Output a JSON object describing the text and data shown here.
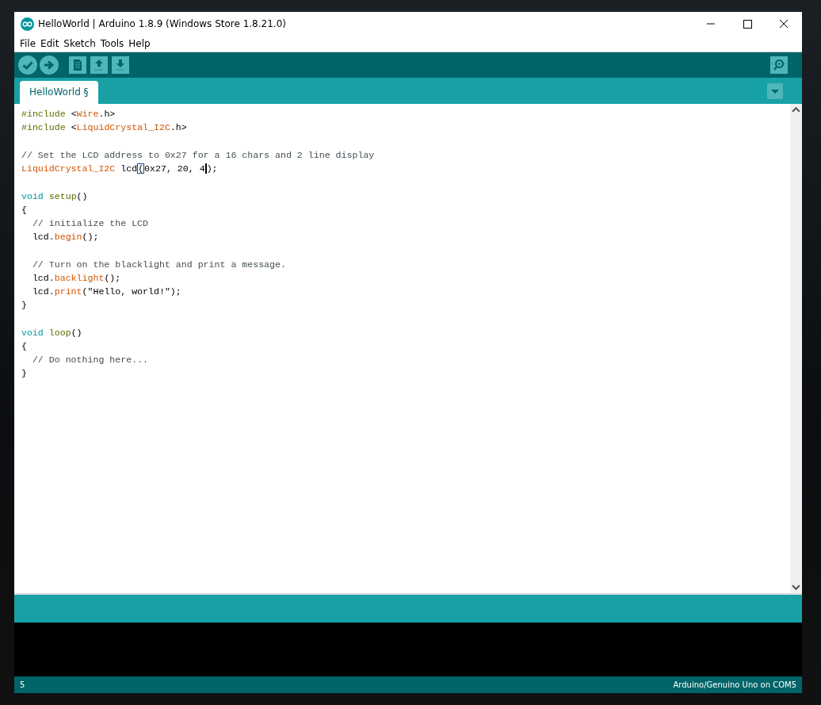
{
  "window": {
    "title": "HelloWorld | Arduino 1.8.9 (Windows Store 1.8.21.0)"
  },
  "menu": [
    "File",
    "Edit",
    "Sketch",
    "Tools",
    "Help"
  ],
  "toolbar": [
    {
      "kind": "verify"
    },
    {
      "kind": "upload"
    },
    {
      "kind": "new"
    },
    {
      "kind": "open"
    },
    {
      "kind": "save"
    }
  ],
  "tabs": [
    {
      "label": "HelloWorld §",
      "selected": true
    }
  ],
  "code": [
    {
      "tokens": [
        {
          "t": "#include ",
          "kind": "pre"
        },
        {
          "t": "<",
          "kind": "plain"
        },
        {
          "t": "Wire",
          "kind": "lib"
        },
        {
          "t": ".h>",
          "kind": "plain"
        }
      ]
    },
    {
      "tokens": [
        {
          "t": "#include ",
          "kind": "pre"
        },
        {
          "t": "<",
          "kind": "plain"
        },
        {
          "t": "LiquidCrystal_I2C",
          "kind": "lib"
        },
        {
          "t": ".h>",
          "kind": "plain"
        }
      ]
    },
    {
      "space_before": true,
      "tokens": [
        {
          "t": "// Set the LCD address to 0x27 for a 16 chars and 2 line display",
          "kind": "comment"
        }
      ]
    },
    {
      "tokens": [
        {
          "t": "LiquidCrystal_I2C",
          "kind": "lib"
        },
        {
          "t": " lcd",
          "kind": "plain"
        },
        {
          "t": "(",
          "kind": "match"
        },
        {
          "t": "0x27, 20, 4",
          "kind": "plain",
          "cursor_after": true
        },
        {
          "t": ");",
          "kind": "plain"
        }
      ]
    },
    {
      "space_before": true,
      "tokens": [
        {
          "t": "void",
          "kind": "type"
        },
        {
          "t": " setup",
          "kind": "pre"
        },
        {
          "t": "()",
          "kind": "plain"
        }
      ]
    },
    {
      "tokens": [
        {
          "t": "{",
          "kind": "plain"
        }
      ]
    },
    {
      "tokens": [
        {
          "t": "  // initialize the LCD",
          "kind": "comment"
        }
      ]
    },
    {
      "tokens": [
        {
          "t": "  lcd.",
          "kind": "plain"
        },
        {
          "t": "begin",
          "kind": "lib"
        },
        {
          "t": "();",
          "kind": "plain"
        }
      ]
    },
    {
      "space_before": true,
      "tokens": [
        {
          "t": "  // Turn on the blacklight and print a message.",
          "kind": "comment"
        }
      ]
    },
    {
      "tokens": [
        {
          "t": "  lcd.",
          "kind": "plain"
        },
        {
          "t": "backlight",
          "kind": "lib"
        },
        {
          "t": "();",
          "kind": "plain"
        }
      ]
    },
    {
      "tokens": [
        {
          "t": "  lcd.",
          "kind": "plain"
        },
        {
          "t": "print",
          "kind": "lib"
        },
        {
          "t": "(\"Hello, world!\");",
          "kind": "plain"
        }
      ]
    },
    {
      "tokens": [
        {
          "t": "}",
          "kind": "plain"
        }
      ]
    },
    {
      "space_before": true,
      "tokens": [
        {
          "t": "void",
          "kind": "type"
        },
        {
          "t": " loop",
          "kind": "pre"
        },
        {
          "t": "()",
          "kind": "plain"
        }
      ]
    },
    {
      "tokens": [
        {
          "t": "{",
          "kind": "plain"
        }
      ]
    },
    {
      "tokens": [
        {
          "t": "  // Do nothing here...",
          "kind": "comment"
        }
      ]
    },
    {
      "tokens": [
        {
          "t": "}",
          "kind": "plain"
        }
      ]
    }
  ],
  "status_bar": {
    "line": "5",
    "board": "Arduino/Genuino Uno on COM5"
  }
}
